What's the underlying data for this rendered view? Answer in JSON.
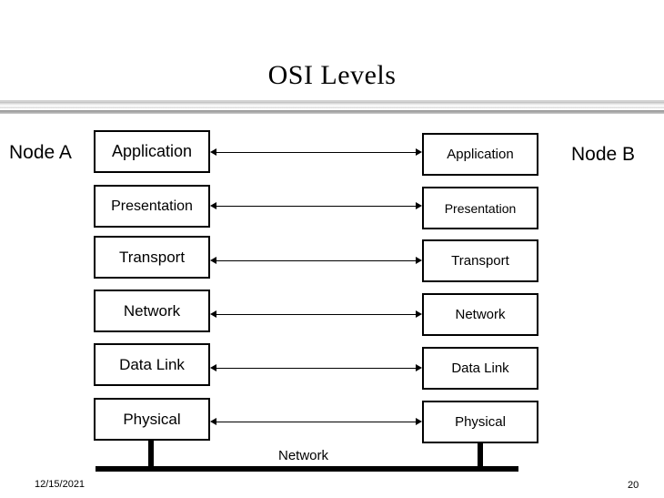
{
  "slide": {
    "title": "OSI Levels",
    "background_color": "#ffffff",
    "text_color": "#000000"
  },
  "nodes": {
    "left_label": "Node A",
    "right_label": "Node B"
  },
  "layers": [
    {
      "name": "Application"
    },
    {
      "name": "Presentation"
    },
    {
      "name": "Transport"
    },
    {
      "name": "Network"
    },
    {
      "name": "Data Link"
    },
    {
      "name": "Physical"
    }
  ],
  "left_stack": {
    "labels": [
      "Application",
      "Presentation",
      "Transport",
      "Network",
      "Data Link",
      "Physical"
    ]
  },
  "right_stack": {
    "labels": [
      "Application",
      "Presentation",
      "Transport",
      "Network",
      "Data Link",
      "Physical"
    ]
  },
  "network": {
    "bus_label": "Network"
  },
  "footer": {
    "date": "12/15/2021",
    "page_number": "20"
  }
}
